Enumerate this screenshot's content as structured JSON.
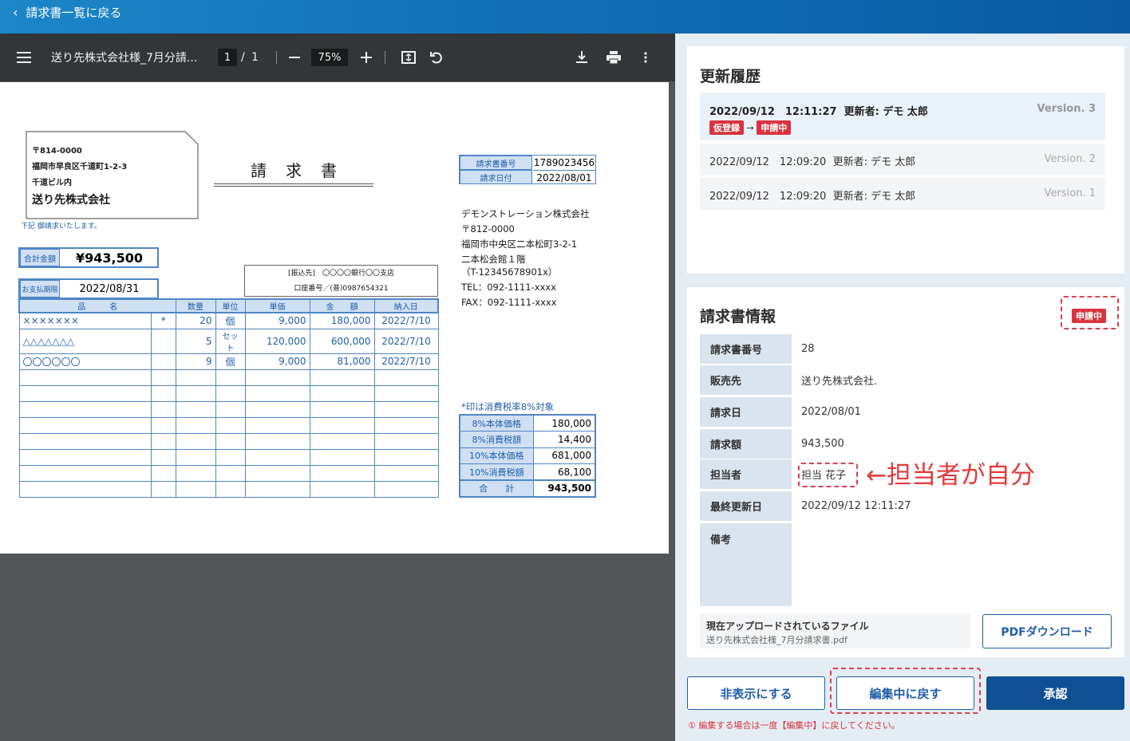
{
  "header": {
    "back_label": "請求書一覧に戻る"
  },
  "pdf_toolbar": {
    "filename": "送り先株式会社様_7月分請...",
    "page_current": "1",
    "page_sep": "/",
    "page_total": "1",
    "zoom": "75%"
  },
  "invoice": {
    "address": {
      "postal": "〒814-0000",
      "line1": "福岡市早良区千道町1-2-3",
      "line2": "千道ビル内",
      "company": "送り先株式会社"
    },
    "note": "下記 御請求いたします。",
    "title": "請　求　書",
    "total_label": "合計金額",
    "total_value": "¥943,500",
    "due_label": "お支払期限",
    "due_value": "2022/08/31",
    "bank_line1": "[振込先]　〇〇〇〇銀行〇〇支店",
    "bank_line2": "口座番号／(普)0987654321",
    "meta": [
      {
        "label": "請求書番号",
        "value": "1789023456"
      },
      {
        "label": "請求日付",
        "value": "2022/08/01"
      }
    ],
    "issuer": [
      "デモンストレーション株式会社",
      "〒812-0000",
      "福岡市中央区二本松町3-2-1",
      "二本松会館１階",
      "（T-12345678901x）",
      "TEL：092-1111-xxxx",
      "FAX：092-1111-xxxx"
    ],
    "columns": [
      "品　　　名",
      "数量",
      "単位",
      "単価",
      "金　　額",
      "納入日"
    ],
    "items": [
      {
        "name": "×××××××",
        "mark": "*",
        "qty": "20",
        "unit": "個",
        "price": "9,000",
        "amount": "180,000",
        "date": "2022/7/10"
      },
      {
        "name": "△△△△△△△",
        "mark": "",
        "qty": "5",
        "unit": "セット",
        "price": "120,000",
        "amount": "600,000",
        "date": "2022/7/10"
      },
      {
        "name": "〇〇〇〇〇〇",
        "mark": "",
        "qty": "9",
        "unit": "個",
        "price": "9,000",
        "amount": "81,000",
        "date": "2022/7/10"
      }
    ],
    "tax_note": "*印は消費税率8%対象",
    "summary": [
      {
        "label": "8%本体価格",
        "value": "180,000"
      },
      {
        "label": "8%消費税額",
        "value": "14,400"
      },
      {
        "label": "10%本体価格",
        "value": "681,000"
      },
      {
        "label": "10%消費税額",
        "value": "68,100"
      },
      {
        "label": "合　　計",
        "value": "943,500"
      }
    ]
  },
  "history": {
    "title": "更新履歴",
    "entries": [
      {
        "datetime": "2022/09/12　12:11:27",
        "user": "更新者: デモ 太郎",
        "version": "Version. 3",
        "from_status": "仮登録",
        "arrow": "→",
        "to_status": "申請中"
      },
      {
        "datetime": "2022/09/12　12:09:20",
        "user": "更新者: デモ 太郎",
        "version": "Version. 2"
      },
      {
        "datetime": "2022/09/12　12:09:20",
        "user": "更新者: デモ 太郎",
        "version": "Version. 1"
      }
    ]
  },
  "info": {
    "title": "請求書情報",
    "status_badge": "申請中",
    "rows": [
      {
        "label": "請求書番号",
        "value": "28"
      },
      {
        "label": "販売先",
        "value": "送り先株式会社."
      },
      {
        "label": "請求日",
        "value": "2022/08/01"
      },
      {
        "label": "請求額",
        "value": "943,500"
      },
      {
        "label": "担当者",
        "value": "担当 花子"
      },
      {
        "label": "最終更新日",
        "value": "2022/09/12 12:11:27"
      },
      {
        "label": "備考",
        "value": ""
      }
    ],
    "annotation": "←担当者が自分",
    "file_label": "現在アップロードされているファイル",
    "file_name": "送り先株式会社様_7月分請求書.pdf",
    "download_label": "PDFダウンロード"
  },
  "actions": {
    "hide_label": "非表示にする",
    "back_to_edit_label": "編集中に戻す",
    "approve_label": "承認",
    "warning": "① 編集する場合は一度【編集中】に戻してください。"
  },
  "colors": {
    "primary": "#0f4f94",
    "status_red": "#d9333f",
    "header_blue": "#1c86c8"
  }
}
